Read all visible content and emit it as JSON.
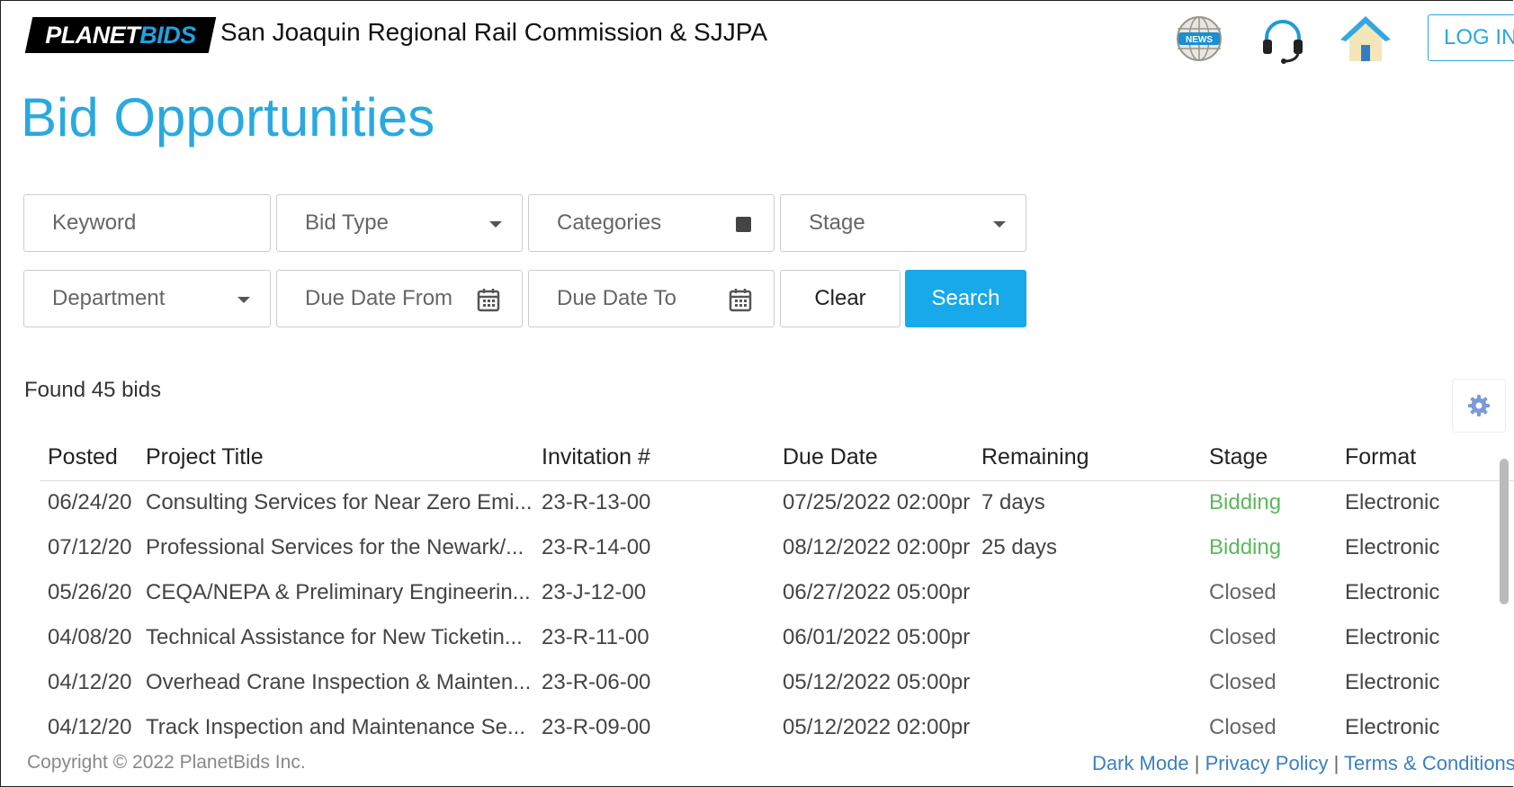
{
  "header": {
    "logo_part1": "PLANET",
    "logo_part2": "BIDS",
    "org_name": "San Joaquin Regional Rail Commission & SJJPA",
    "news_badge": "NEWS",
    "login_label": "LOG IN",
    "icons": [
      "news-globe-icon",
      "headset-icon",
      "home-icon"
    ]
  },
  "page_title": "Bid Opportunities",
  "filters": {
    "keyword_placeholder": "Keyword",
    "bid_type_placeholder": "Bid Type",
    "categories_placeholder": "Categories",
    "stage_placeholder": "Stage",
    "department_placeholder": "Department",
    "due_date_from_placeholder": "Due Date From",
    "due_date_to_placeholder": "Due Date To",
    "clear_label": "Clear",
    "search_label": "Search"
  },
  "results": {
    "found_text": "Found 45 bids"
  },
  "table": {
    "headers": {
      "posted": "Posted",
      "title": "Project Title",
      "invitation": "Invitation #",
      "due_date": "Due Date",
      "remaining": "Remaining",
      "stage": "Stage",
      "format": "Format"
    },
    "rows": [
      {
        "posted": "06/24/20",
        "title": "Consulting Services for Near Zero Emi...",
        "invitation": "23-R-13-00",
        "due_date": "07/25/2022 02:00pr",
        "remaining": "7 days",
        "stage": "Bidding",
        "format": "Electronic"
      },
      {
        "posted": "07/12/20",
        "title": "Professional Services for the Newark/...",
        "invitation": "23-R-14-00",
        "due_date": "08/12/2022 02:00pr",
        "remaining": "25 days",
        "stage": "Bidding",
        "format": "Electronic"
      },
      {
        "posted": "05/26/20",
        "title": "CEQA/NEPA & Preliminary Engineerin...",
        "invitation": "23-J-12-00",
        "due_date": "06/27/2022 05:00pr",
        "remaining": "",
        "stage": "Closed",
        "format": "Electronic"
      },
      {
        "posted": "04/08/20",
        "title": "Technical Assistance for New Ticketin...",
        "invitation": "23-R-11-00",
        "due_date": "06/01/2022 05:00pr",
        "remaining": "",
        "stage": "Closed",
        "format": "Electronic"
      },
      {
        "posted": "04/12/20",
        "title": "Overhead Crane Inspection & Mainten...",
        "invitation": "23-R-06-00",
        "due_date": "05/12/2022 05:00pr",
        "remaining": "",
        "stage": "Closed",
        "format": "Electronic"
      },
      {
        "posted": "04/12/20",
        "title": "Track Inspection and Maintenance Se...",
        "invitation": "23-R-09-00",
        "due_date": "05/12/2022 02:00pr",
        "remaining": "",
        "stage": "Closed",
        "format": "Electronic"
      }
    ]
  },
  "footer": {
    "copyright": "Copyright © 2022 PlanetBids Inc.",
    "dark_mode": "Dark Mode",
    "privacy_policy": "Privacy Policy",
    "terms": "Terms & Conditions",
    "separator": "|"
  },
  "colors": {
    "accent": "#29a9df",
    "search_button": "#17a9ea",
    "bidding": "#5cb85c",
    "link": "#3a7fc4",
    "gear": "#7b9ad6"
  }
}
